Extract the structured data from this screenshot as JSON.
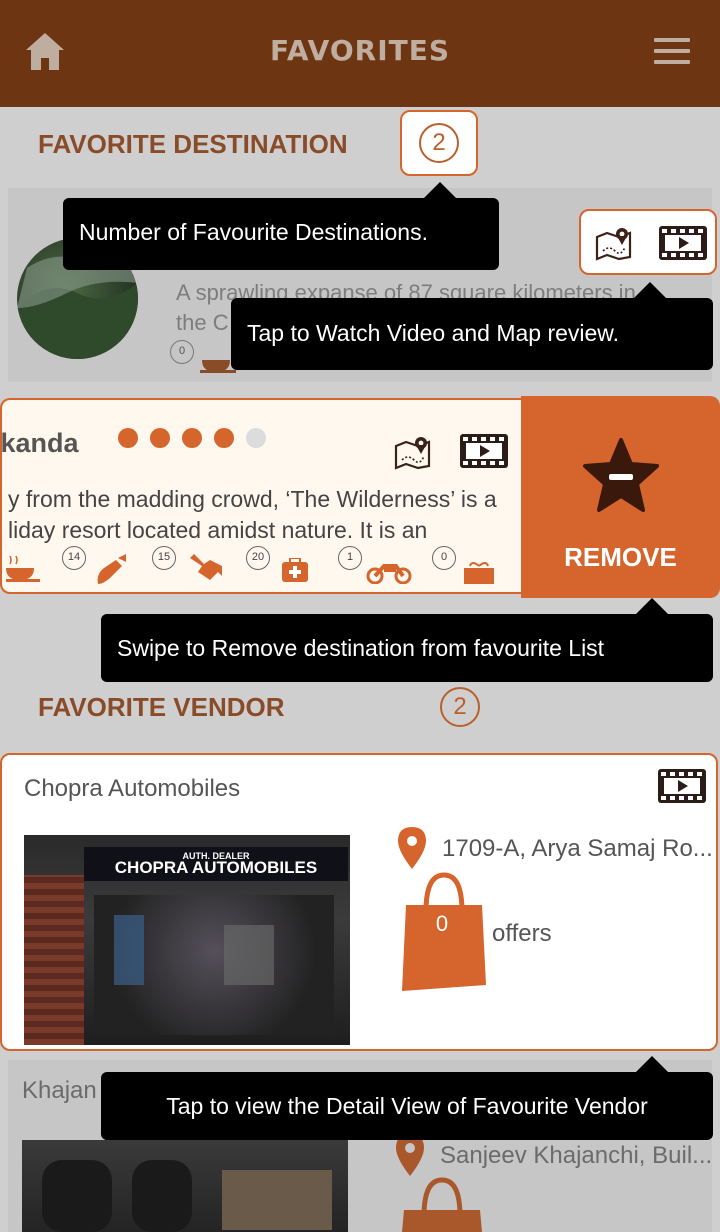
{
  "header": {
    "title": "FAVORITES",
    "home_icon": "home-icon",
    "menu_icon": "hamburger-menu-icon"
  },
  "destinations": {
    "section_title": "FAVORITE DESTINATION",
    "count": "2",
    "items": [
      {
        "description_line1": "A sprawling expanse of 87 square kilometers in",
        "description_line2": "the C",
        "first_count": "0"
      },
      {
        "name": "rkanda",
        "rating": 4,
        "rating_max": 5,
        "description_line1": "y from the madding crowd, ‘The Wilderness’ is a",
        "description_line2": "liday resort located amidst nature. It is an",
        "amenities": [
          {
            "icon": "cafe-icon",
            "count": ""
          },
          {
            "icon": "fuel-icon",
            "count": "14"
          },
          {
            "icon": "mechanic-icon",
            "count": "15"
          },
          {
            "icon": "medical-icon",
            "count": "20"
          },
          {
            "icon": "motorbike-icon",
            "count": "1"
          },
          {
            "icon": "gift-icon",
            "count": "0"
          }
        ],
        "remove_label": "REMOVE"
      }
    ]
  },
  "vendors": {
    "section_title": "FAVORITE VENDOR",
    "count": "2",
    "items": [
      {
        "name": "Chopra Automobiles",
        "sign_small": "AUTH. DEALER",
        "sign_text": "CHOPRA AUTOMOBILES",
        "address": "1709-A, Arya Samaj Ro...",
        "offers_count": "0",
        "offers_label": "offers"
      },
      {
        "name": "Khajan",
        "address": "Sanjeev Khajanchi, Buil..."
      }
    ]
  },
  "tooltips": {
    "count": "Number of Favourite Destinations.",
    "video_map": "Tap to Watch Video and Map review.",
    "remove": "Swipe to Remove destination from favourite List",
    "vendor": "Tap to view the Detail View of Favourite Vendor"
  },
  "colors": {
    "header": "#6e3513",
    "accent": "#d5652c",
    "section_title": "#8a4b28",
    "overlay_bg": "#cfcfcf"
  }
}
